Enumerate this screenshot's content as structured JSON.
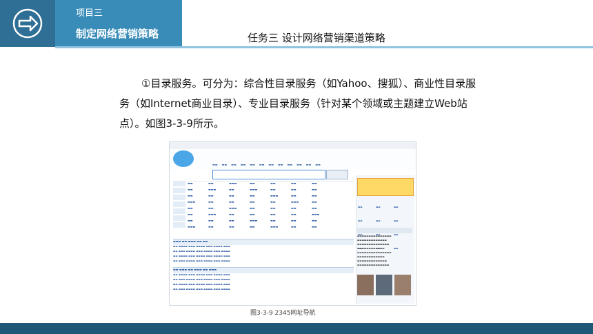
{
  "header": {
    "course_label": "项目三",
    "chapter_title": "制定网络营销策略",
    "task_title": "任务三   设计网络营销渠道策略"
  },
  "body": {
    "paragraph": "①目录服务。可分为：综合性目录服务（如Yahoo、搜狐）、商业性目录服务（如Internet商业目录）、专业目录服务（针对某个领域或主题建立Web站点）。如图3-3-9所示。"
  },
  "figure": {
    "caption": "图3-3-9  2345网址导航"
  },
  "colors": {
    "logo_box": "#2f6f95",
    "tab_strip": "#3a8cb8",
    "footer": "#1d5877",
    "accent_line": "#8fc3de"
  },
  "icons": {
    "logo": "right-arrow-circle-icon"
  }
}
